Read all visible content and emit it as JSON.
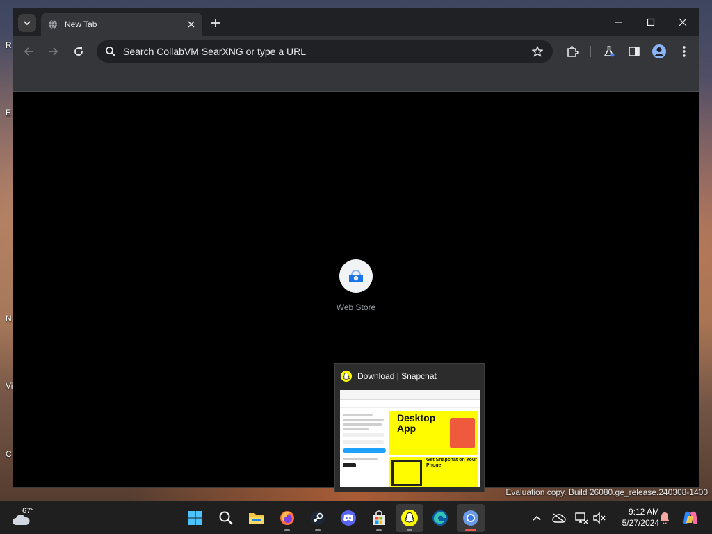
{
  "browser": {
    "tab_title": "New Tab",
    "omnibox_placeholder": "Search CollabVM SearXNG or type a URL",
    "shortcuts": [
      {
        "label": "Web Store"
      }
    ]
  },
  "preview": {
    "title": "Download | Snapchat",
    "thumb_heading_1": "Desktop",
    "thumb_heading_2": "App",
    "thumb_heading_3": "Get Snapchat on Your Phone"
  },
  "desktop": {
    "watermark": "Evaluation copy. Build 26080.ge_release.240308-1400",
    "icon_labels": [
      "R",
      "E",
      "N",
      "Vis",
      "C"
    ]
  },
  "taskbar": {
    "weather_temp": "67°",
    "clock_time": "9:12 AM",
    "clock_date": "5/27/2024",
    "apps": [
      "windows-start",
      "search",
      "file-explorer",
      "firefox",
      "steam",
      "discord",
      "microsoft-store",
      "snapchat",
      "edge",
      "chromium"
    ]
  },
  "colors": {
    "tab_active": "#35363a",
    "tabstrip": "#202124",
    "snapchat_yellow": "#fffc00",
    "accent_blue": "#1a73e8"
  }
}
